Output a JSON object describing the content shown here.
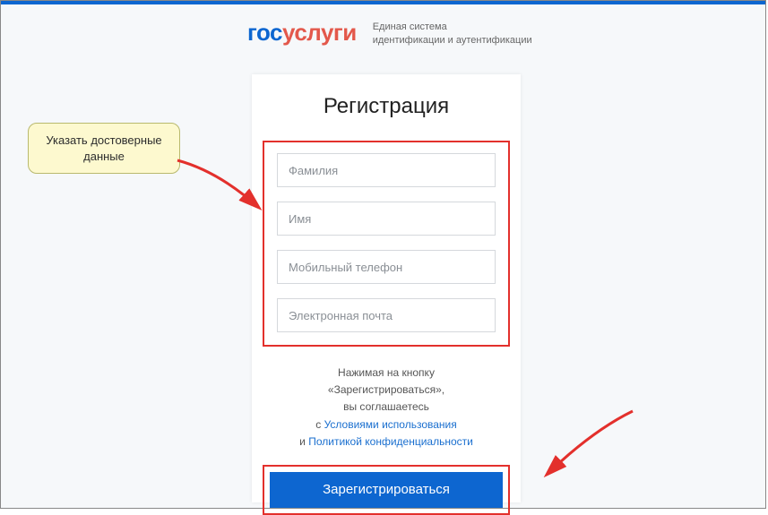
{
  "logo": {
    "part1": "гос",
    "part2": "услуги"
  },
  "subtitle_line1": "Единая система",
  "subtitle_line2": "идентификации и аутентификации",
  "title": "Регистрация",
  "fields": {
    "surname": "Фамилия",
    "name": "Имя",
    "phone": "Мобильный телефон",
    "email": "Электронная почта"
  },
  "agree": {
    "line1": "Нажимая на кнопку",
    "line2": "«Зарегистрироваться»,",
    "line3": "вы соглашаетесь",
    "with": "с ",
    "terms": "Условиями использования",
    "and": "и ",
    "privacy": "Политикой конфиденциальности"
  },
  "button": "Зарегистрироваться",
  "callout": "Указать достоверные данные"
}
